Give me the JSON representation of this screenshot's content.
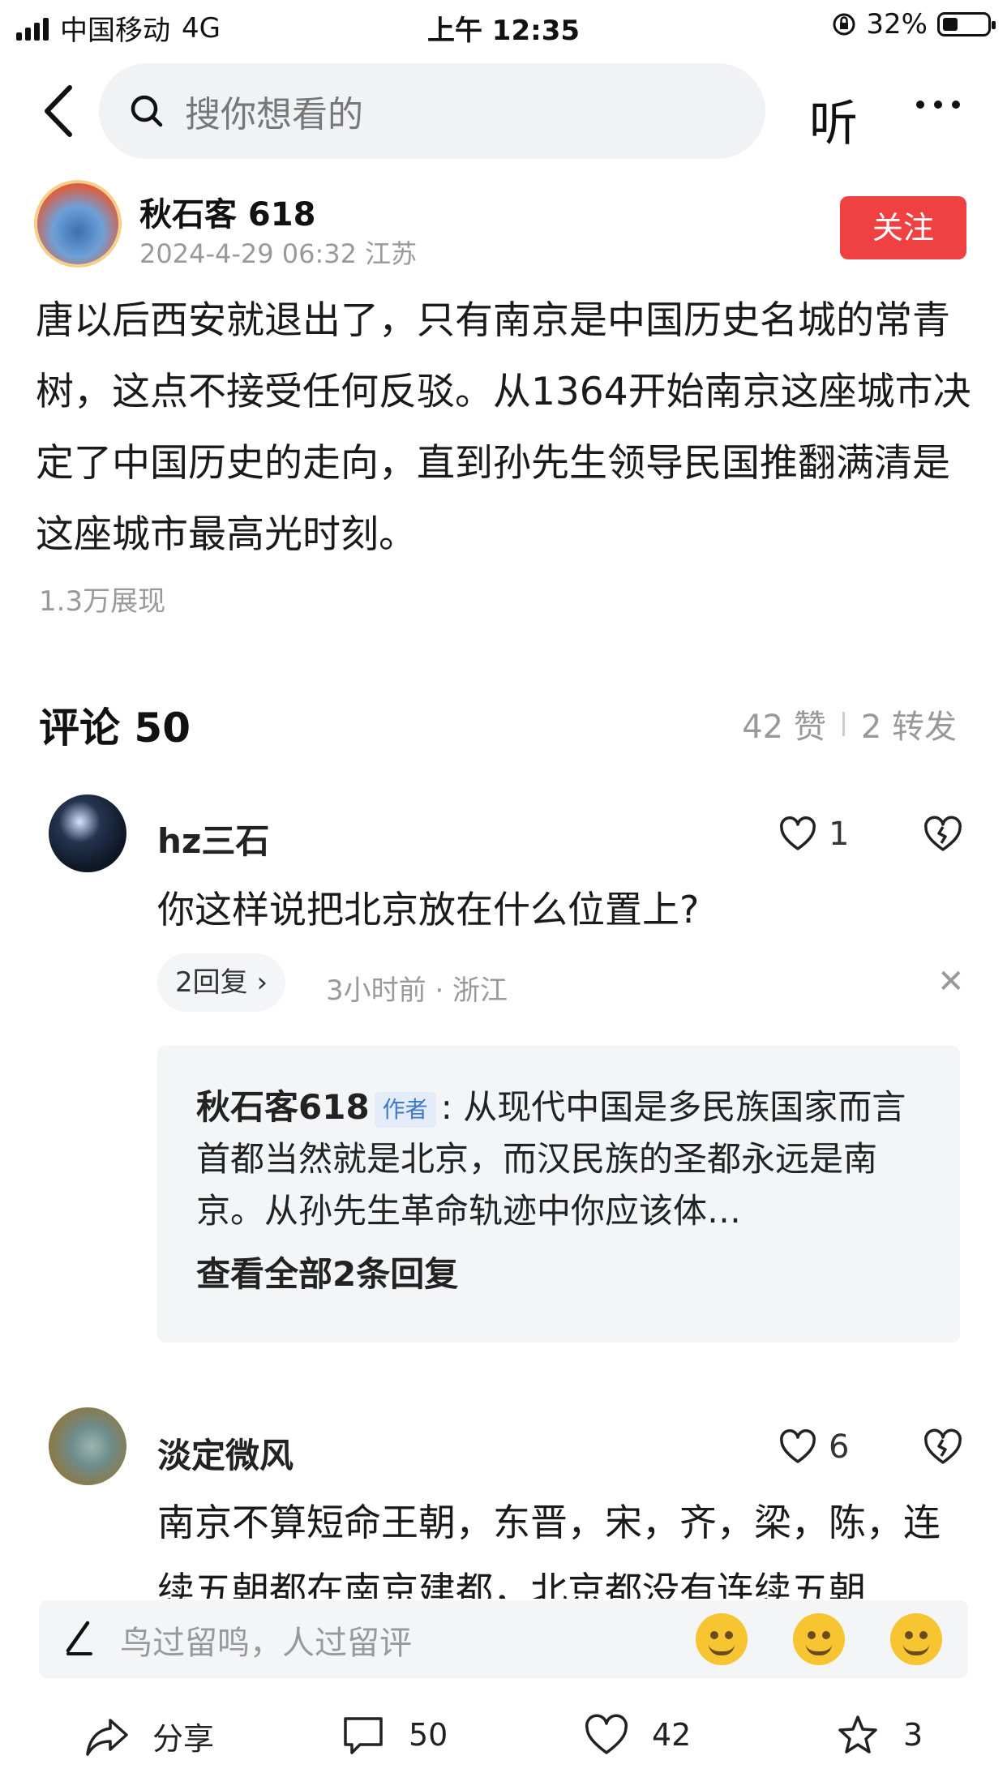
{
  "status_bar": {
    "carrier": "中国移动",
    "network": "4G",
    "time": "上午 12:35",
    "battery": "32%",
    "battery_level": 0.32
  },
  "nav": {
    "search_placeholder": "搜你想看的",
    "listen_label": "听",
    "icons": [
      "back-arrow-icon",
      "search-icon",
      "more-icon"
    ]
  },
  "post": {
    "author": "秋石客 618",
    "meta": "2024-4-29 06:32  江苏",
    "follow_label": "关注",
    "body": "唐以后西安就退出了，只有南京是中国历史名城的常青树，这点不接受任何反驳。从1364开始南京这座城市决定了中国历史的走向，直到孙先生领导民国推翻满清是这座城市最高光时刻。",
    "views": "1.3万展现"
  },
  "comments_header": {
    "title": "评论 50",
    "likes": "42 赞",
    "shares": "2 转发"
  },
  "comments": [
    {
      "name": "hz三石",
      "likes": "1",
      "text": "你这样说把北京放在什么位置上?",
      "replies_label": "2回复",
      "time_location": "3小时前 · 浙江",
      "reply": {
        "name": "秋石客618",
        "tag": "作者",
        "text": ": 从现代中国是多民族国家而言首都当然就是北京，而汉民族的圣都永远是南京。从孙先生革命轨迹中你应该体…",
        "view_all": "查看全部2条回复"
      }
    },
    {
      "name": "淡定微风",
      "likes": "6",
      "text": "南京不算短命王朝，东晋，宋，齐，梁，陈，连续五朝都在南京建都，北京都没有连续五朝"
    }
  ],
  "input_bar": {
    "placeholder": "鸟过留鸣，人过留评"
  },
  "toolbar": {
    "share_label": "分享",
    "comment_count": "50",
    "like_count": "42",
    "favorite_count": "3"
  },
  "colors": {
    "accent_red": "#f04142",
    "author_tag_blue": "#3f79c9"
  }
}
